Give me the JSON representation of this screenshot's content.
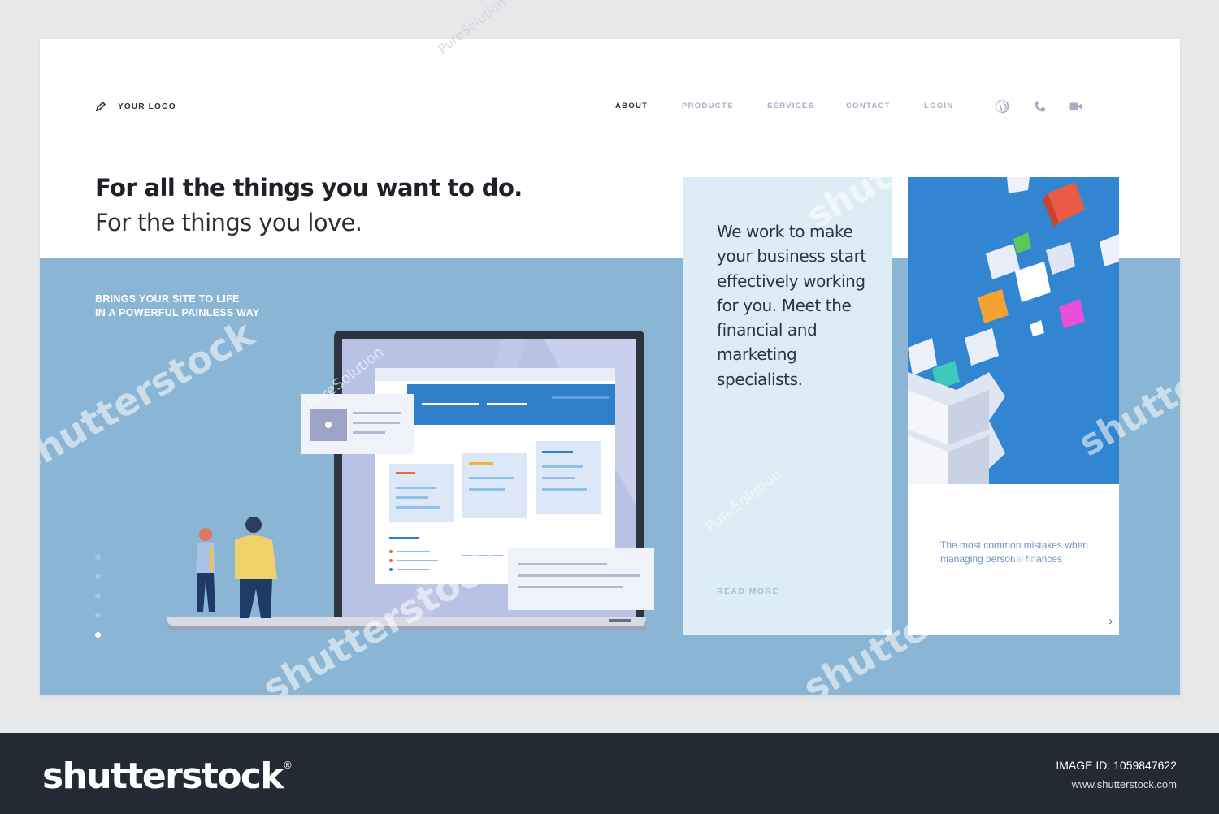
{
  "header": {
    "logo_text": "YOUR LOGO",
    "nav": [
      "ABOUT",
      "PRODUCTS",
      "SERVICES",
      "CONTACT",
      "LOGIN"
    ],
    "active_nav": "ABOUT",
    "icons": [
      "globe-icon",
      "phone-icon",
      "video-icon"
    ]
  },
  "hero": {
    "headline": "For all the things you want to do.",
    "subline": "For the things you love.",
    "tagline_line1": "BRINGS YOUR SITE TO LIFE",
    "tagline_line2": "IN A POWERFUL PAINLESS WAY",
    "slide_count": 5,
    "active_slide": 5
  },
  "mid_card": {
    "text": "We work to make your business start effectively working for you. Meet the financial and marketing specialists.",
    "read_more": "READ MORE"
  },
  "right_card": {
    "text": "The most common mistakes when managing personal finances",
    "arrow": "›"
  },
  "footer": {
    "brand": "shutterstock",
    "brand_mark": "®",
    "image_id": "IMAGE ID: 1059847622",
    "url": "www.shutterstock.com"
  },
  "watermarks": {
    "brand": "shutterstock",
    "author": "PureSolution"
  },
  "colors": {
    "accent_blue": "#3286d1",
    "band_blue": "#8ab5d5",
    "card_light": "#ddedf6",
    "footer_bg": "#242a33"
  }
}
